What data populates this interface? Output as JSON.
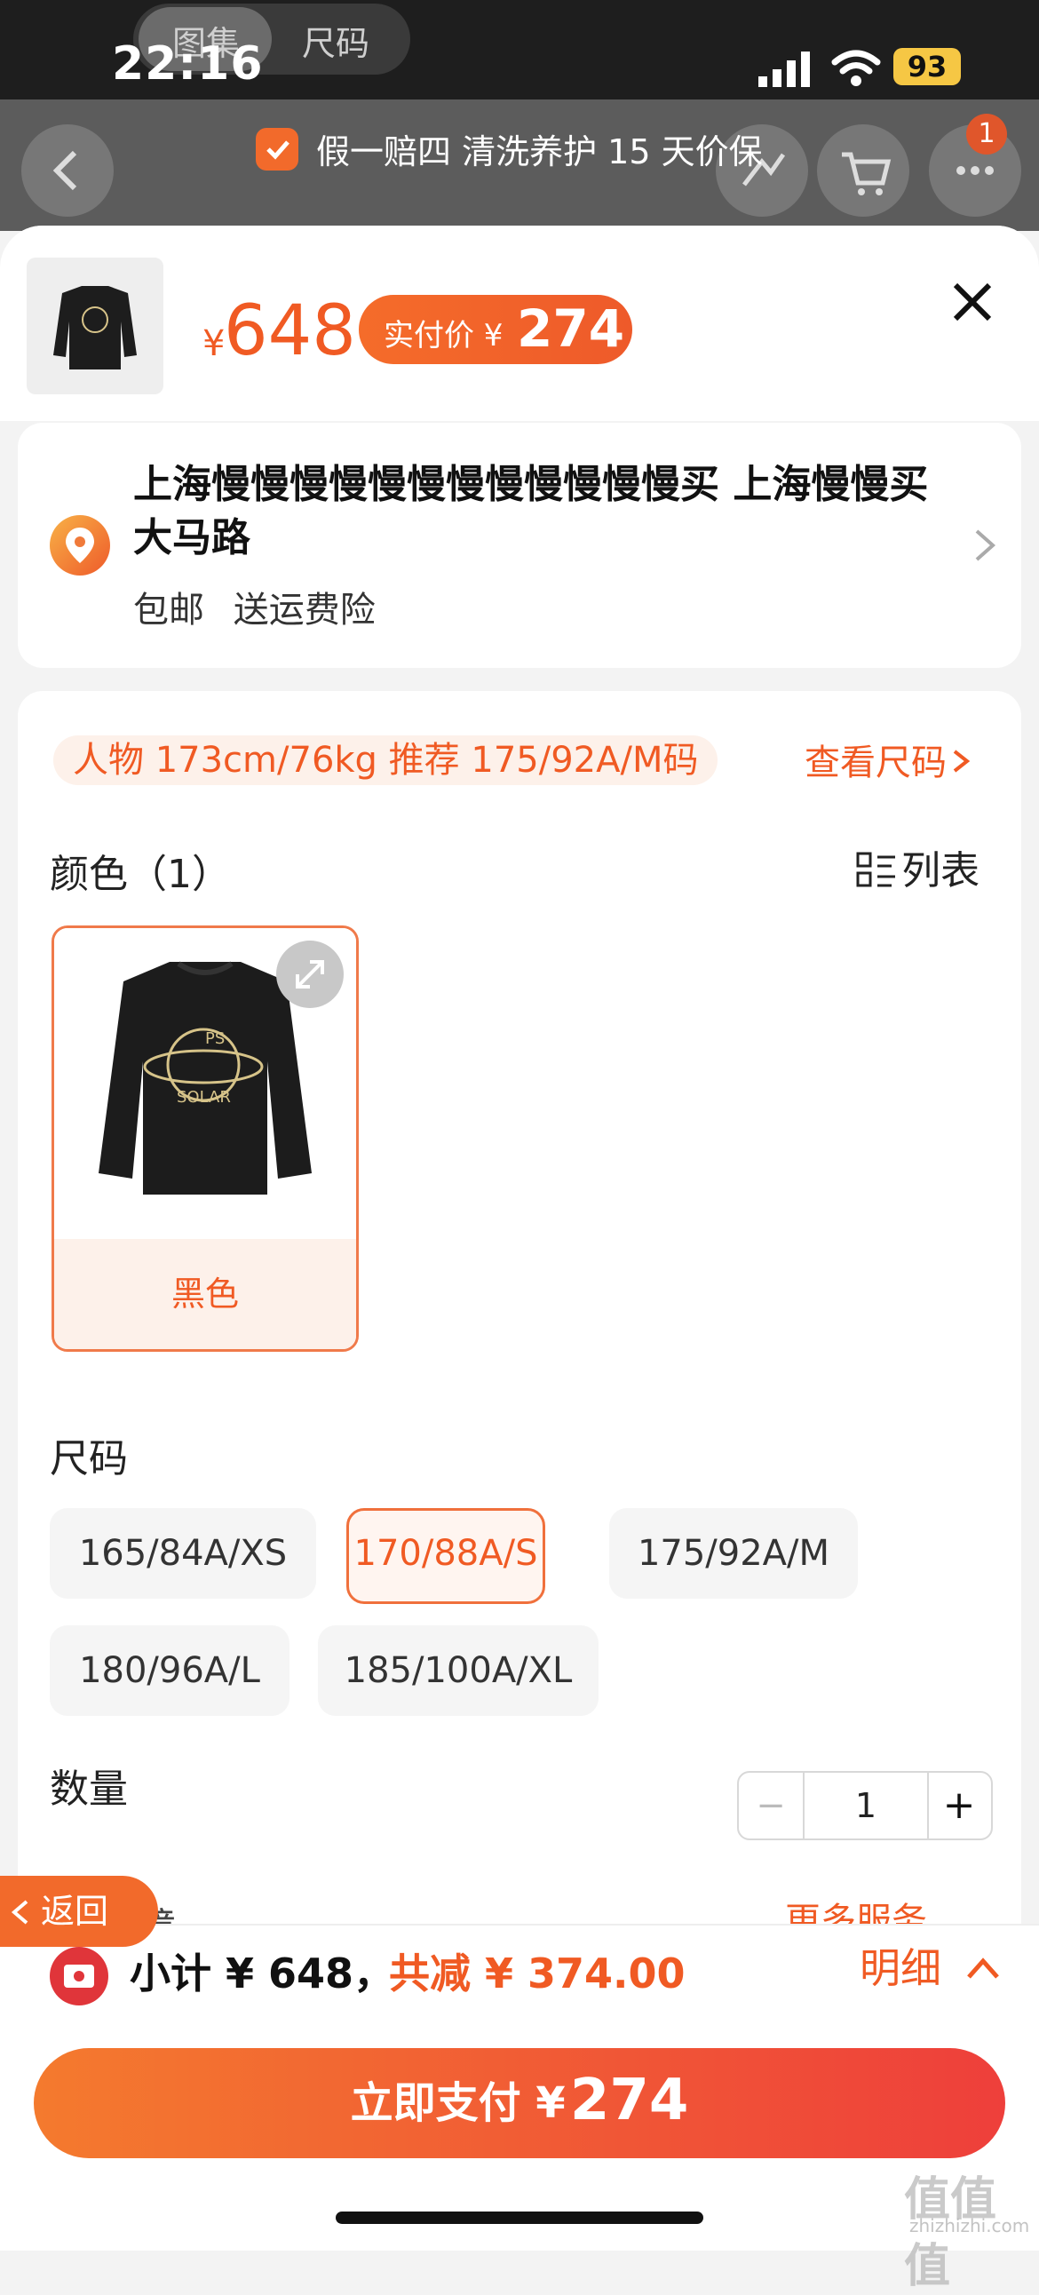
{
  "status": {
    "time": "22:16",
    "battery": "93"
  },
  "top_tabs": {
    "gallery": "图集",
    "size": "尺码"
  },
  "nav": {
    "badge": "1"
  },
  "guarantee": "假一赔四 清洗养护 15 天价保",
  "header": {
    "currency": "¥",
    "price": "648",
    "paid_label": "实付价 ¥",
    "paid_value": "274"
  },
  "address": {
    "text": "上海慢慢慢慢慢慢慢慢慢慢慢慢买 上海慢慢买大马路",
    "shipping": "包邮",
    "insurance": "送运费险"
  },
  "recommend": {
    "text": "人物 173cm/76kg 推荐 175/92A/M码",
    "link": "查看尺码"
  },
  "color": {
    "label": "颜色（1）",
    "list_label": "列表",
    "option": "黑色"
  },
  "size": {
    "label": "尺码",
    "options": [
      "165/84A/XS",
      "170/88A/S",
      "175/92A/M",
      "180/96A/L",
      "185/100A/XL"
    ],
    "selected": "170/88A/S"
  },
  "quantity": {
    "label": "数量",
    "minus": "−",
    "value": "1",
    "plus": "+"
  },
  "service": {
    "label": "保障",
    "link": "更多服务"
  },
  "summary": {
    "subtotal": "小计 ¥ 648，",
    "discount": "共减 ¥ 374.00",
    "detail": "明细"
  },
  "pay": {
    "label": "立即支付 ¥",
    "value": "274"
  },
  "back": "返回",
  "watermark": {
    "main": "值值值",
    "sub": "zhizhizhi.com"
  },
  "colors": {
    "accent": "#f05a23",
    "pay_start": "#f47a2e",
    "pay_end": "#ee3f3b"
  }
}
